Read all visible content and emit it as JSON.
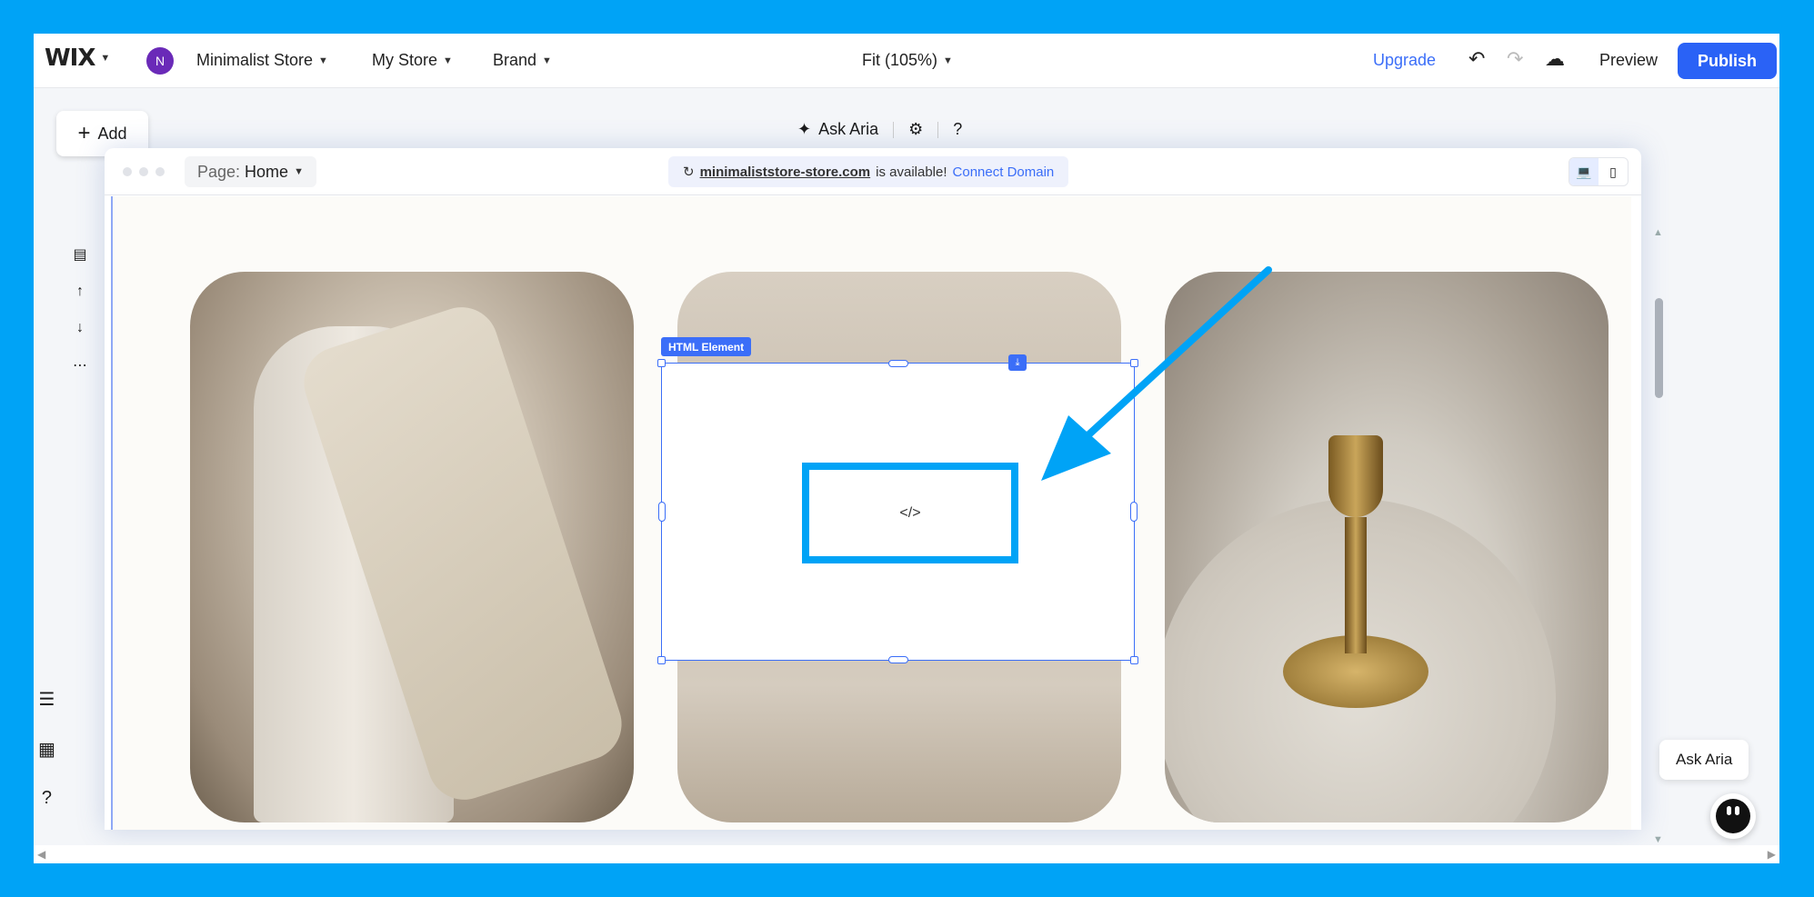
{
  "topbar": {
    "logo": "WIX",
    "avatar_initial": "N",
    "site_name": "Minimalist Store",
    "menu_my_store": "My Store",
    "menu_brand": "Brand",
    "zoom": "Fit (105%)",
    "upgrade": "Upgrade",
    "preview": "Preview",
    "publish": "Publish"
  },
  "add_button": {
    "label": "Add",
    "icon": "plus-icon"
  },
  "toolbar": {
    "ask_aria": "Ask Aria",
    "help": "?"
  },
  "frame": {
    "page_prefix": "Page:",
    "page_name": "Home",
    "domain": "minimaliststore-store.com",
    "domain_status": "is available!",
    "connect_domain": "Connect Domain"
  },
  "element": {
    "tag": "HTML Element",
    "code_glyph": "</>"
  },
  "left_bottom": {
    "help": "?"
  },
  "aria": {
    "tooltip": "Ask Aria"
  },
  "colors": {
    "accent": "#3b6ef8",
    "brand_blue": "#2a62f6",
    "highlight": "#00a3f6",
    "avatar": "#6a2ab8"
  }
}
